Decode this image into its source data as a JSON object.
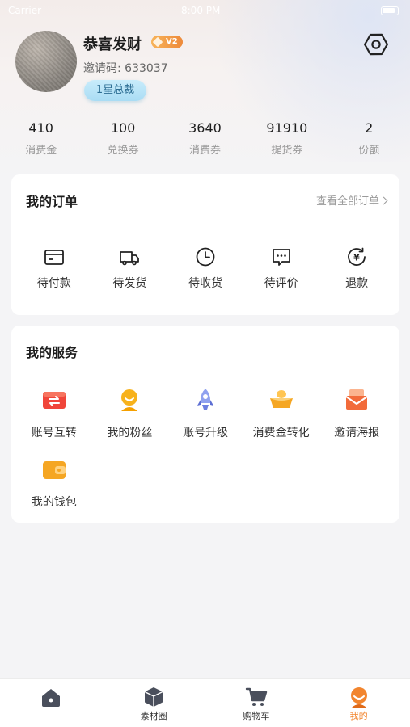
{
  "status_bar": {
    "carrier": "Carrier",
    "time": "8:00 PM"
  },
  "profile": {
    "nickname": "恭喜发财",
    "vip_badge": "V2",
    "invite_code": "邀请码: 633037",
    "rank_label": "1星总裁"
  },
  "stats": [
    {
      "value": "410",
      "label": "消费金"
    },
    {
      "value": "100",
      "label": "兑换券"
    },
    {
      "value": "3640",
      "label": "消费券"
    },
    {
      "value": "91910",
      "label": "提货券"
    },
    {
      "value": "2",
      "label": "份额"
    }
  ],
  "orders": {
    "title": "我的订单",
    "view_all": "查看全部订单",
    "items": [
      {
        "label": "待付款",
        "icon": "card-icon"
      },
      {
        "label": "待发货",
        "icon": "truck-icon"
      },
      {
        "label": "待收货",
        "icon": "clock-icon"
      },
      {
        "label": "待评价",
        "icon": "comment-icon"
      },
      {
        "label": "退款",
        "icon": "refund-icon"
      }
    ]
  },
  "services": {
    "title": "我的服务",
    "items": [
      {
        "label": "账号互转",
        "icon": "transfer-icon",
        "color": "#f0453a"
      },
      {
        "label": "我的粉丝",
        "icon": "fans-icon",
        "color": "#f7b21c"
      },
      {
        "label": "账号升级",
        "icon": "rocket-icon",
        "color": "#6c7fe0"
      },
      {
        "label": "消费金转化",
        "icon": "gold-ingot-icon",
        "color": "#f5a623"
      },
      {
        "label": "邀请海报",
        "icon": "envelope-icon",
        "color": "#f26b3a"
      },
      {
        "label": "我的钱包",
        "icon": "wallet-icon",
        "color": "#f5a623"
      }
    ]
  },
  "tabbar": {
    "items": [
      {
        "label": "",
        "icon": "home-icon"
      },
      {
        "label": "素材圈",
        "icon": "cube-icon"
      },
      {
        "label": "购物车",
        "icon": "cart-icon"
      },
      {
        "label": "我的",
        "icon": "profile-icon",
        "active": true
      }
    ],
    "accent": "#f2852e"
  }
}
